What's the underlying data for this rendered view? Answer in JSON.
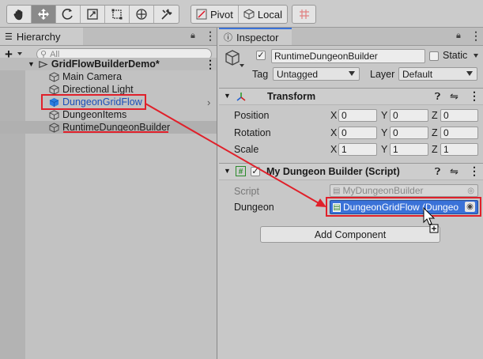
{
  "toolbar": {
    "tools": [
      "hand-tool",
      "move-tool",
      "rotate-tool",
      "scale-tool",
      "rect-tool",
      "transform-tool",
      "custom-tool"
    ],
    "pivot_label": "Pivot",
    "local_label": "Local"
  },
  "hierarchy": {
    "tab_label": "Hierarchy",
    "add_symbol": "+",
    "search_placeholder": "All",
    "scene_name": "GridFlowBuilderDemo*",
    "items": [
      {
        "label": "Main Camera"
      },
      {
        "label": "Directional Light"
      },
      {
        "label": "DungeonGridFlow"
      },
      {
        "label": "DungeonItems"
      },
      {
        "label": "RuntimeDungeonBuilder"
      }
    ]
  },
  "inspector": {
    "tab_label": "Inspector",
    "object_name": "RuntimeDungeonBuilder",
    "static_label": "Static",
    "tag_label": "Tag",
    "tag_value": "Untagged",
    "layer_label": "Layer",
    "layer_value": "Default",
    "transform": {
      "title": "Transform",
      "rows": [
        {
          "label": "Position",
          "x": "0",
          "y": "0",
          "z": "0"
        },
        {
          "label": "Rotation",
          "x": "0",
          "y": "0",
          "z": "0"
        },
        {
          "label": "Scale",
          "x": "1",
          "y": "1",
          "z": "1"
        }
      ],
      "axis_x": "X",
      "axis_y": "Y",
      "axis_z": "Z"
    },
    "script_component": {
      "title": "My Dungeon Builder (Script)",
      "script_label": "Script",
      "script_value": "MyDungeonBuilder",
      "dungeon_label": "Dungeon",
      "dungeon_value": "DungeonGridFlow (Dungeo"
    },
    "add_component_label": "Add Component"
  },
  "colors": {
    "highlight_red": "#e0202a",
    "selection_blue": "#3a72d8",
    "link_blue": "#1a4fb8"
  }
}
